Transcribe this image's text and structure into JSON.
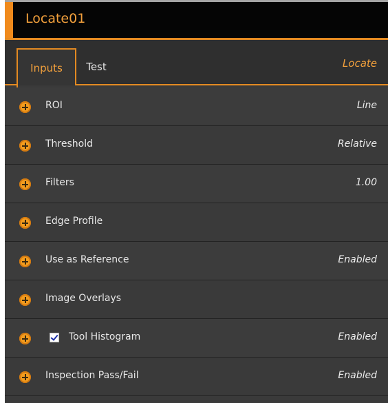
{
  "tool": {
    "title": "Locate01"
  },
  "tabs": {
    "inputs_label": "Inputs",
    "test_label": "Test",
    "tool_type": "Locate"
  },
  "rows": [
    {
      "label": "ROI",
      "value": "Line"
    },
    {
      "label": "Threshold",
      "value": "Relative"
    },
    {
      "label": "Filters",
      "value": "1.00"
    },
    {
      "label": "Edge Profile",
      "value": ""
    },
    {
      "label": "Use as Reference",
      "value": "Enabled"
    },
    {
      "label": "Image Overlays",
      "value": ""
    },
    {
      "label": "Tool Histogram",
      "value": "Enabled",
      "checked": true
    },
    {
      "label": "Inspection Pass/Fail",
      "value": "Enabled"
    }
  ],
  "icons": {
    "expand": "plus-circle-icon",
    "check": "checkbox-checked-icon"
  },
  "colors": {
    "accent": "#e38a22",
    "title_text": "#f2a03c",
    "panel": "#3a3a3a",
    "header": "#050505"
  }
}
